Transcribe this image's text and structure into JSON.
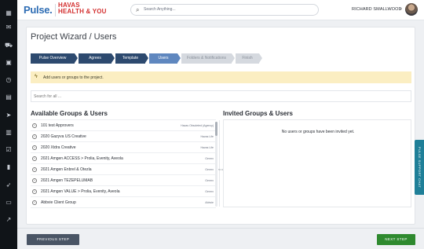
{
  "header": {
    "logo_pulse": "Pulse.",
    "logo_havas_line1": "HAVAS",
    "logo_havas_line2": "HEALTH & YOU",
    "search_placeholder": "Search Anything...",
    "user_name": "RICHARD SMALLWOOD"
  },
  "rail": {
    "icons": [
      "dashboard-icon",
      "mail-icon",
      "cart-icon",
      "calendar-icon",
      "clock-icon",
      "image-icon",
      "send-icon",
      "building-icon",
      "checklist-icon",
      "book-icon",
      "rocket-icon",
      "folder-icon",
      "chart-icon"
    ]
  },
  "page": {
    "title": "Project Wizard / Users"
  },
  "steps": [
    {
      "label": "Pulse Overview",
      "state": "done"
    },
    {
      "label": "Agrees",
      "state": "done"
    },
    {
      "label": "Template",
      "state": "done"
    },
    {
      "label": "Users",
      "state": "active"
    },
    {
      "label": "Folders & Notifications",
      "state": "todo"
    },
    {
      "label": "Finish",
      "state": "todo"
    }
  ],
  "banner": {
    "icon": "lightning-icon",
    "text": "Add users or groups to the project."
  },
  "search_all": {
    "placeholder": "Search for all ..."
  },
  "available": {
    "title": "Available Groups & Users",
    "rows": [
      {
        "name": "101 test Approvers",
        "tag": "Havas Obsoleted (Agency)"
      },
      {
        "name": "2020 Gazyva US Creative",
        "tag": "Havas Life"
      },
      {
        "name": "2020 Xtdra Creative",
        "tag": "Havas Life"
      },
      {
        "name": "2021 Amgen ACCESS > Prolia, Evenity, Aveola",
        "tag": "Genrrx"
      },
      {
        "name": "2021 Amgen Enbrel & Otezla",
        "tag": "Genrrx"
      },
      {
        "name": "2021 Amgen TEZEPELUMAB",
        "tag": "Genrrx"
      },
      {
        "name": "2021 Amgen VALUE > Prolia, Evenity, Aveola",
        "tag": "Genrrx"
      },
      {
        "name": "Abbvie Client Group",
        "tag": "Abbvie"
      }
    ]
  },
  "invited": {
    "title": "Invited Groups & Users",
    "empty_text": "No users or groups have been invited yet."
  },
  "footer": {
    "prev_label": "PREVIOUS STEP",
    "next_label": "NEXT STEP"
  },
  "support": {
    "label": "PULSE SUPPORT CHAT"
  },
  "colors": {
    "step_done": "#2d4a6f",
    "step_active": "#5f87bf",
    "step_todo": "#d5d9df",
    "next_button": "#2f8a2f",
    "prev_button": "#4a5565",
    "banner": "#fbeec2",
    "support": "#1f7f98"
  }
}
